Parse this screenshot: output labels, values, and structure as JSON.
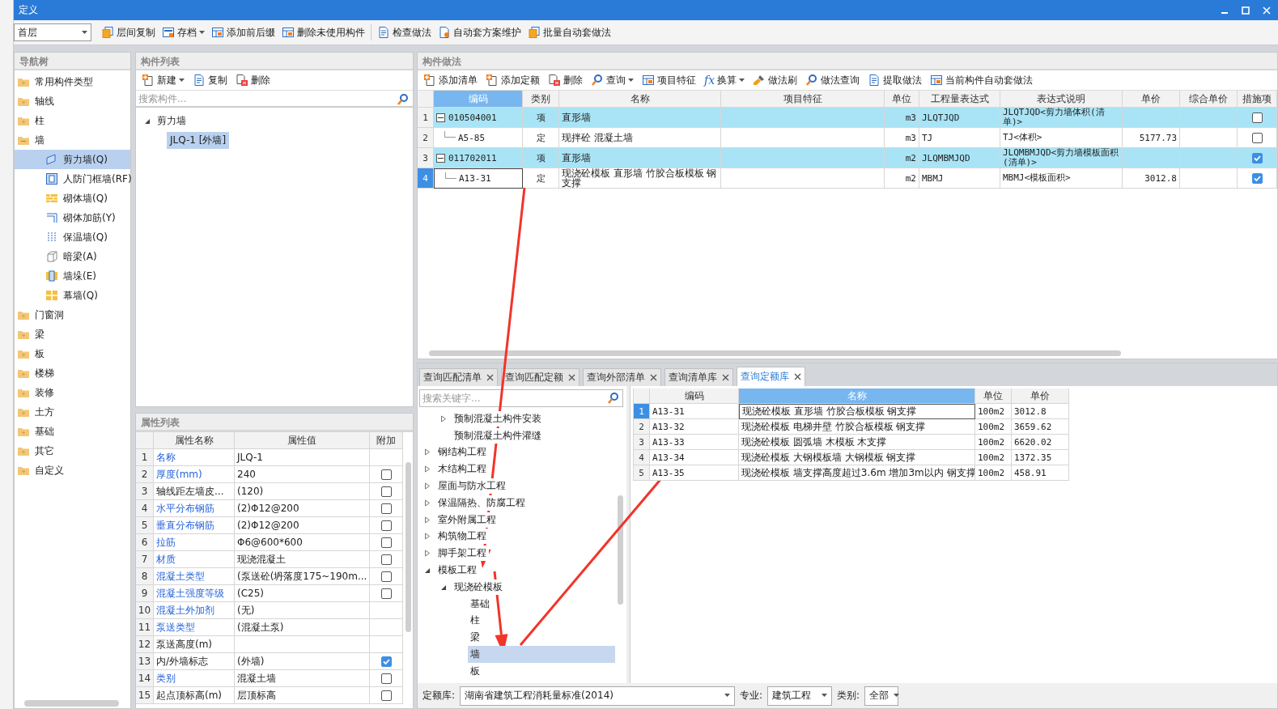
{
  "window": {
    "title": "定义"
  },
  "toolbar": {
    "floor": "首层",
    "buttons": [
      {
        "label": "层间复制",
        "dropdown": false
      },
      {
        "label": "存档",
        "dropdown": true
      },
      {
        "label": "添加前后缀",
        "dropdown": false
      },
      {
        "label": "删除未使用构件",
        "dropdown": false
      },
      {
        "label": "检查做法",
        "dropdown": false
      },
      {
        "label": "自动套方案维护",
        "dropdown": false
      },
      {
        "label": "批量自动套做法",
        "dropdown": false
      }
    ]
  },
  "nav": {
    "title": "导航树",
    "items": [
      {
        "label": "常用构件类型",
        "expanded": false
      },
      {
        "label": "轴线",
        "expanded": false
      },
      {
        "label": "柱",
        "expanded": false
      },
      {
        "label": "墙",
        "expanded": true,
        "children": [
          {
            "label": "剪力墙(Q)",
            "selected": true
          },
          {
            "label": "人防门框墙(RF)",
            "selected": false
          },
          {
            "label": "砌体墙(Q)",
            "selected": false
          },
          {
            "label": "砌体加筋(Y)",
            "selected": false
          },
          {
            "label": "保温墙(Q)",
            "selected": false
          },
          {
            "label": "暗梁(A)",
            "selected": false
          },
          {
            "label": "墙垛(E)",
            "selected": false
          },
          {
            "label": "幕墙(Q)",
            "selected": false
          }
        ]
      },
      {
        "label": "门窗洞",
        "expanded": false
      },
      {
        "label": "梁",
        "expanded": false
      },
      {
        "label": "板",
        "expanded": false
      },
      {
        "label": "楼梯",
        "expanded": false
      },
      {
        "label": "装修",
        "expanded": false
      },
      {
        "label": "土方",
        "expanded": false
      },
      {
        "label": "基础",
        "expanded": false
      },
      {
        "label": "其它",
        "expanded": false
      },
      {
        "label": "自定义",
        "expanded": false
      }
    ]
  },
  "components": {
    "title": "构件列表",
    "toolbar": [
      {
        "label": "新建",
        "dropdown": true
      },
      {
        "label": "复制",
        "dropdown": false
      },
      {
        "label": "删除",
        "dropdown": false
      }
    ],
    "search": {
      "placeholder": "搜索构件..."
    },
    "tree": [
      {
        "label": "剪力墙",
        "expanded": true,
        "children": [
          {
            "label": "JLQ-1 [外墙]",
            "selected": true
          }
        ]
      }
    ]
  },
  "properties": {
    "title": "属性列表",
    "columns": [
      "属性名称",
      "属性值",
      "附加"
    ],
    "rows": [
      {
        "no": "1",
        "name": "名称",
        "link": true,
        "value": "JLQ-1",
        "kind": "plain"
      },
      {
        "no": "2",
        "name": "厚度(mm)",
        "link": true,
        "value": "240",
        "kind": "check",
        "checked": false
      },
      {
        "no": "3",
        "name": "轴线距左墙皮...",
        "link": false,
        "value": "(120)",
        "kind": "check",
        "checked": false
      },
      {
        "no": "4",
        "name": "水平分布钢筋",
        "link": true,
        "value": "(2)Φ12@200",
        "kind": "check",
        "checked": false
      },
      {
        "no": "5",
        "name": "垂直分布钢筋",
        "link": true,
        "value": "(2)Φ12@200",
        "kind": "check",
        "checked": false
      },
      {
        "no": "6",
        "name": "拉筋",
        "link": true,
        "value": "Φ6@600*600",
        "kind": "check",
        "checked": false
      },
      {
        "no": "7",
        "name": "材质",
        "link": true,
        "value": "现浇混凝土",
        "kind": "check",
        "checked": false
      },
      {
        "no": "8",
        "name": "混凝土类型",
        "link": true,
        "value": "(泵送砼(坍落度175~190m...",
        "kind": "check",
        "checked": false
      },
      {
        "no": "9",
        "name": "混凝土强度等级",
        "link": true,
        "value": "(C25)",
        "kind": "check",
        "checked": false
      },
      {
        "no": "10",
        "name": "混凝土外加剂",
        "link": true,
        "value": "(无)",
        "kind": "plain"
      },
      {
        "no": "11",
        "name": "泵送类型",
        "link": true,
        "value": "(混凝土泵)",
        "kind": "plain"
      },
      {
        "no": "12",
        "name": "泵送高度(m)",
        "link": false,
        "kind": "plain"
      },
      {
        "no": "13",
        "name": "内/外墙标志",
        "link": false,
        "value": "(外墙)",
        "kind": "check",
        "checked": true
      },
      {
        "no": "14",
        "name": "类别",
        "link": true,
        "value": "混凝土墙",
        "kind": "check",
        "checked": false
      },
      {
        "no": "15",
        "name": "起点顶标高(m)",
        "link": false,
        "value": "层顶标高",
        "kind": "check",
        "checked": false
      }
    ]
  },
  "methods": {
    "title": "构件做法",
    "toolbar": [
      {
        "label": "添加清单",
        "dropdown": false
      },
      {
        "label": "添加定额",
        "dropdown": false
      },
      {
        "label": "删除",
        "dropdown": false
      },
      {
        "label": "查询",
        "dropdown": true
      },
      {
        "label": "项目特征",
        "dropdown": false
      },
      {
        "label": "换算",
        "dropdown": true,
        "glyph": "fx"
      },
      {
        "label": "做法刷",
        "dropdown": false
      },
      {
        "label": "做法查询",
        "dropdown": false
      },
      {
        "label": "提取做法",
        "dropdown": false
      },
      {
        "label": "当前构件自动套做法",
        "dropdown": false
      }
    ],
    "columns": [
      {
        "label": "编码",
        "selected": true
      },
      {
        "label": "类别",
        "selected": false
      },
      {
        "label": "名称",
        "selected": false
      },
      {
        "label": "项目特征",
        "selected": false
      },
      {
        "label": "单位",
        "selected": false
      },
      {
        "label": "工程量表达式",
        "selected": false
      },
      {
        "label": "表达式说明",
        "selected": false
      },
      {
        "label": "单价",
        "selected": false
      },
      {
        "label": "综合单价",
        "selected": false
      },
      {
        "label": "措施项",
        "selected": false
      }
    ],
    "rows": [
      {
        "no": "1",
        "kind": "list",
        "selected": false,
        "code": "010504001",
        "type": "项",
        "name": "直形墙",
        "unit": "m3",
        "expr": "JLQTJQD",
        "desc": "JLQTJQD<剪力墙体积(清单)>",
        "measure": false
      },
      {
        "no": "2",
        "kind": "quota",
        "selected": false,
        "code": "A5-85",
        "type": "定",
        "name": "现拌砼 混凝土墙",
        "unit": "m3",
        "expr": "TJ",
        "desc": "TJ<体积>",
        "price": "5177.73",
        "measure": false
      },
      {
        "no": "3",
        "kind": "list",
        "selected": false,
        "code": "011702011",
        "type": "项",
        "name": "直形墙",
        "unit": "m2",
        "expr": "JLQMBMJQD",
        "desc": "JLQMBMJQD<剪力墙模板面积(清单)>",
        "measure": true
      },
      {
        "no": "4",
        "kind": "quota",
        "selected": true,
        "code": "A13-31",
        "type": "定",
        "name": "现浇砼模板 直形墙 竹胶合板模板 钢支撑",
        "unit": "m2",
        "expr": "MBMJ",
        "desc": "MBMJ<模板面积>",
        "price": "3012.8",
        "measure": true
      }
    ]
  },
  "query": {
    "tabs": [
      {
        "label": "查询匹配清单",
        "selected": false
      },
      {
        "label": "查询匹配定额",
        "selected": false
      },
      {
        "label": "查询外部清单",
        "selected": false
      },
      {
        "label": "查询清单库",
        "selected": false
      },
      {
        "label": "查询定额库",
        "selected": true
      }
    ],
    "search": {
      "placeholder": "搜索关键字..."
    },
    "tree": [
      {
        "children": [
          {
            "label": "预制混凝土构件安装",
            "expanded": false
          },
          {
            "label": "预制混凝土构件灌缝"
          }
        ]
      },
      {
        "label": "钢结构工程",
        "expanded": false
      },
      {
        "label": "木结构工程",
        "expanded": false
      },
      {
        "label": "屋面与防水工程",
        "expanded": false
      },
      {
        "label": "保温隔热、防腐工程",
        "expanded": false
      },
      {
        "label": "室外附属工程",
        "expanded": false
      },
      {
        "label": "构筑物工程",
        "expanded": false
      },
      {
        "label": "脚手架工程",
        "expanded": false
      },
      {
        "label": "模板工程",
        "expanded": true,
        "children": [
          {
            "label": "现浇砼模板",
            "expanded": true,
            "children": [
              {
                "label": "基础",
                "selected": false
              },
              {
                "label": "柱",
                "selected": false
              },
              {
                "label": "梁",
                "selected": false
              },
              {
                "label": "墙",
                "selected": true
              },
              {
                "label": "板",
                "selected": false
              }
            ]
          }
        ]
      }
    ],
    "columns": [
      {
        "label": "编码",
        "selected": false
      },
      {
        "label": "名称",
        "selected": true
      },
      {
        "label": "单位",
        "selected": false
      },
      {
        "label": "单价",
        "selected": false
      }
    ],
    "rows": [
      {
        "no": "1",
        "selected": true,
        "code": "A13-31",
        "name": "现浇砼模板 直形墙 竹胶合板模板 钢支撑",
        "unit": "100m2",
        "price": "3012.8"
      },
      {
        "no": "2",
        "selected": false,
        "code": "A13-32",
        "name": "现浇砼模板 电梯井壁 竹胶合板模板 钢支撑",
        "unit": "100m2",
        "price": "3659.62"
      },
      {
        "no": "3",
        "selected": false,
        "code": "A13-33",
        "name": "现浇砼模板 圆弧墙 木模板 木支撑",
        "unit": "100m2",
        "price": "6620.02"
      },
      {
        "no": "4",
        "selected": false,
        "code": "A13-34",
        "name": "现浇砼模板 大钢模板墙 大钢模板 钢支撑",
        "unit": "100m2",
        "price": "1372.35"
      },
      {
        "no": "5",
        "selected": false,
        "code": "A13-35",
        "name": "现浇砼模板 墙支撑高度超过3.6m 增加3m以内 钢支撑",
        "unit": "100m2",
        "price": "458.91"
      }
    ],
    "footer": [
      {
        "label": "定额库:",
        "value": "湖南省建筑工程消耗量标准(2014)"
      },
      {
        "label": "专业:",
        "value": "建筑工程"
      },
      {
        "label": "类别:",
        "value": "全部"
      }
    ]
  },
  "annotations": [
    {
      "kind": "arrow"
    },
    {
      "kind": "arrow"
    },
    {
      "kind": "arrow"
    }
  ]
}
